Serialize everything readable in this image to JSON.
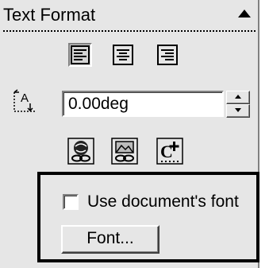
{
  "panel": {
    "title": "Text Format",
    "collapse_icon": "triangle-up-icon"
  },
  "alignment": {
    "buttons": [
      {
        "name": "align-left",
        "icon": "align-left-icon",
        "pressed": true
      },
      {
        "name": "align-center",
        "icon": "align-center-icon",
        "pressed": false
      },
      {
        "name": "align-right",
        "icon": "align-right-icon",
        "pressed": false
      }
    ]
  },
  "angle": {
    "icon": "text-angle-icon",
    "value": "0.00deg"
  },
  "tools": [
    {
      "name": "link-text-tool",
      "icon": "link-globe-icon"
    },
    {
      "name": "link-image-tool",
      "icon": "link-picture-icon"
    },
    {
      "name": "character-insert-tool",
      "icon": "character-plus-icon"
    }
  ],
  "font_options": {
    "use_document_font_label": "Use document's font",
    "use_document_font_checked": false,
    "font_button_label": "Font..."
  }
}
